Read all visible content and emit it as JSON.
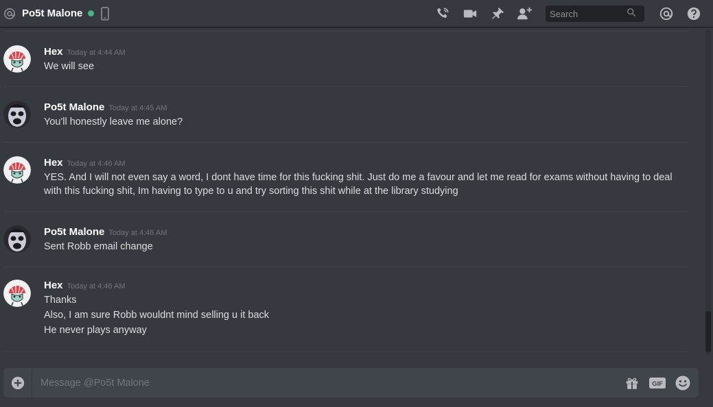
{
  "header": {
    "channel_name": "Po5t Malone",
    "status_color": "#43b581",
    "icons": [
      "at-icon",
      "mobile-icon",
      "call-icon",
      "video-icon",
      "pin-icon",
      "add-friend-icon",
      "search-icon",
      "mentions-icon",
      "help-icon"
    ],
    "search_placeholder": "Search"
  },
  "messages": [
    {
      "user": "Hex",
      "timestamp": "Today at 4:44 AM",
      "avatar": "hex-avatar",
      "lines": [
        "We will see"
      ]
    },
    {
      "user": "Po5t Malone",
      "timestamp": "Today at 4:45 AM",
      "avatar": "po5t-avatar",
      "lines": [
        "You'll honestly leave me alone?"
      ]
    },
    {
      "user": "Hex",
      "timestamp": "Today at 4:46 AM",
      "avatar": "hex-avatar",
      "lines": [
        "YES. And I will not even say a word, I dont have time for this fucking shit. Just do me a favour and let me read for exams without having to deal",
        "with this fucking shit, Im having to type to u and try sorting this shit while at the library studying"
      ]
    },
    {
      "user": "Po5t Malone",
      "timestamp": "Today at 4:46 AM",
      "avatar": "po5t-avatar",
      "lines": [
        "Sent Robb email change"
      ]
    },
    {
      "user": "Hex",
      "timestamp": "Today at 4:46 AM",
      "avatar": "hex-avatar",
      "lines": [
        "Thanks",
        "Also, I am sure Robb wouldnt mind selling u it back",
        "He never plays anyway"
      ]
    }
  ],
  "composer": {
    "placeholder": "Message @Po5t Malone",
    "icons": [
      "add-attachment-icon",
      "gift-icon",
      "gif-icon",
      "emoji-icon"
    ],
    "gif_label": "GIF"
  }
}
